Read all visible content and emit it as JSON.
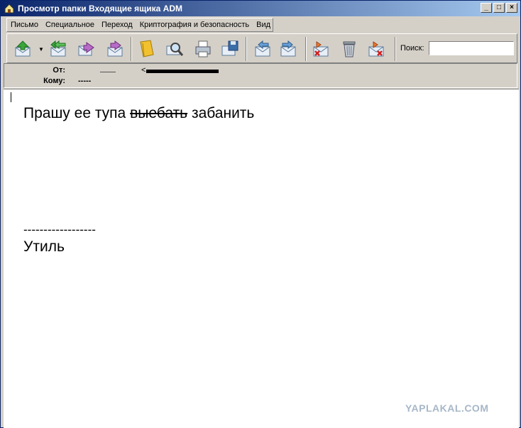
{
  "window": {
    "title": "Просмотр папки Входящие ящика ADM",
    "controls": [
      "_",
      "□",
      "×"
    ]
  },
  "menu": [
    {
      "label": "Письмо"
    },
    {
      "label": "Специальное"
    },
    {
      "label": "Переход"
    },
    {
      "label": "Криптография и безопасность"
    },
    {
      "label": "Вид"
    }
  ],
  "toolbar": {
    "buttons": [
      {
        "icon": "get-mail-icon"
      },
      {
        "icon": "reply-all-icon"
      },
      {
        "icon": "forward-icon"
      },
      {
        "icon": "redirect-icon"
      },
      {
        "icon": "address-book-icon"
      },
      {
        "icon": "find-icon"
      },
      {
        "icon": "print-icon"
      },
      {
        "icon": "save-icon"
      },
      {
        "icon": "previous-icon"
      },
      {
        "icon": "next-icon"
      },
      {
        "icon": "delete-icon"
      },
      {
        "icon": "trash-icon"
      },
      {
        "icon": "junk-icon"
      }
    ],
    "search_label": "Поиск:",
    "search_value": ""
  },
  "headers": {
    "from_label": "От:",
    "from_value": "<",
    "to_label": "Кому:",
    "to_value": "-----"
  },
  "message": {
    "line_start": "Прашу ее тупа ",
    "line_struck": "выебать",
    "line_end": " забанить",
    "separator": "------------------",
    "signature": "Утиль"
  },
  "watermark": "YAPLAKAL.COM",
  "colors": {
    "titlebar_start": "#0a246a",
    "titlebar_end": "#a6caf0",
    "chrome": "#d4d0c8",
    "watermark": "#a7b7c7"
  }
}
